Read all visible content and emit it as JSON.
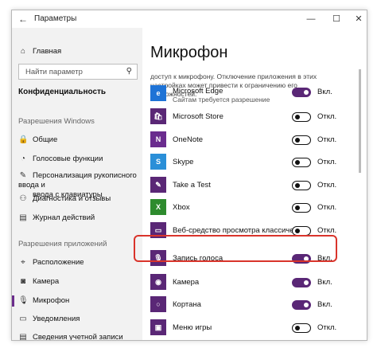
{
  "window": {
    "title": "Параметры",
    "back_glyph": "←",
    "min_glyph": "—",
    "max_glyph": "☐",
    "close_glyph": "✕"
  },
  "sidebar": {
    "home": {
      "label": "Главная",
      "icon": "home-icon"
    },
    "search": {
      "placeholder": "Найти параметр",
      "icon": "search-icon"
    },
    "heading": "Конфиденциальность",
    "section_windows": "Разрешения Windows",
    "windows_items": [
      {
        "label": "Общие",
        "icon": "lock-icon"
      },
      {
        "label": "Голосовые функции",
        "icon": "speech-icon"
      },
      {
        "label": "Персонализация рукописного ввода и",
        "label2": "ввода с клавиатуры",
        "icon": "pen-icon"
      },
      {
        "label": "Диагностика и отзывы",
        "icon": "diagnostics-icon"
      },
      {
        "label": "Журнал действий",
        "icon": "journal-icon"
      }
    ],
    "section_apps": "Разрешения приложений",
    "app_items": [
      {
        "label": "Расположение",
        "icon": "location-icon"
      },
      {
        "label": "Камера",
        "icon": "camera-icon"
      },
      {
        "label": "Микрофон",
        "icon": "microphone-icon",
        "active": true
      },
      {
        "label": "Уведомления",
        "icon": "notifications-icon"
      },
      {
        "label": "Сведения учетной записи",
        "icon": "account-icon"
      }
    ]
  },
  "main": {
    "title": "Микрофон",
    "description": "доступ к микрофону. Отключение приложения в этих настройках может привести к ограничению его возможностей.",
    "apps": [
      {
        "name": "Microsoft Edge",
        "sub": "Сайтам требуется разрешение",
        "state": "on",
        "state_label": "Вкл.",
        "tile_color": "#1e73d6",
        "icon": "edge-icon",
        "glyph": "e"
      },
      {
        "name": "Microsoft Store",
        "sub": "",
        "state": "off",
        "state_label": "Откл.",
        "tile_color": "#5a2776",
        "icon": "store-icon",
        "glyph": "🛍"
      },
      {
        "name": "OneNote",
        "sub": "",
        "state": "off",
        "state_label": "Откл.",
        "tile_color": "#6a2c8e",
        "icon": "onenote-icon",
        "glyph": "N"
      },
      {
        "name": "Skype",
        "sub": "",
        "state": "off",
        "state_label": "Откл.",
        "tile_color": "#2a8fd8",
        "icon": "skype-icon",
        "glyph": "S"
      },
      {
        "name": "Take a Test",
        "sub": "",
        "state": "off",
        "state_label": "Откл.",
        "tile_color": "#5a2776",
        "icon": "take-a-test-icon",
        "glyph": "✎"
      },
      {
        "name": "Xbox",
        "sub": "",
        "state": "off",
        "state_label": "Откл.",
        "tile_color": "#2e8b2e",
        "icon": "xbox-icon",
        "glyph": "X"
      },
      {
        "name": "Веб-средство просмотра классических",
        "sub": "",
        "state": "off",
        "state_label": "Откл.",
        "tile_color": "#5a2776",
        "icon": "web-viewer-icon",
        "glyph": "▭"
      },
      {
        "name": "Запись голоса",
        "sub": "",
        "state": "on",
        "state_label": "Вкл.",
        "tile_color": "#5a2776",
        "icon": "voice-recorder-icon",
        "glyph": "🎙",
        "highlighted": true
      },
      {
        "name": "Камера",
        "sub": "",
        "state": "on",
        "state_label": "Вкл.",
        "tile_color": "#5a2776",
        "icon": "camera-app-icon",
        "glyph": "◉"
      },
      {
        "name": "Кортана",
        "sub": "",
        "state": "on",
        "state_label": "Вкл.",
        "tile_color": "#5a2776",
        "icon": "cortana-icon",
        "glyph": "○"
      },
      {
        "name": "Меню игры",
        "sub": "",
        "state": "off",
        "state_label": "Откл.",
        "tile_color": "#5a2776",
        "icon": "game-bar-icon",
        "glyph": "▣"
      }
    ]
  }
}
